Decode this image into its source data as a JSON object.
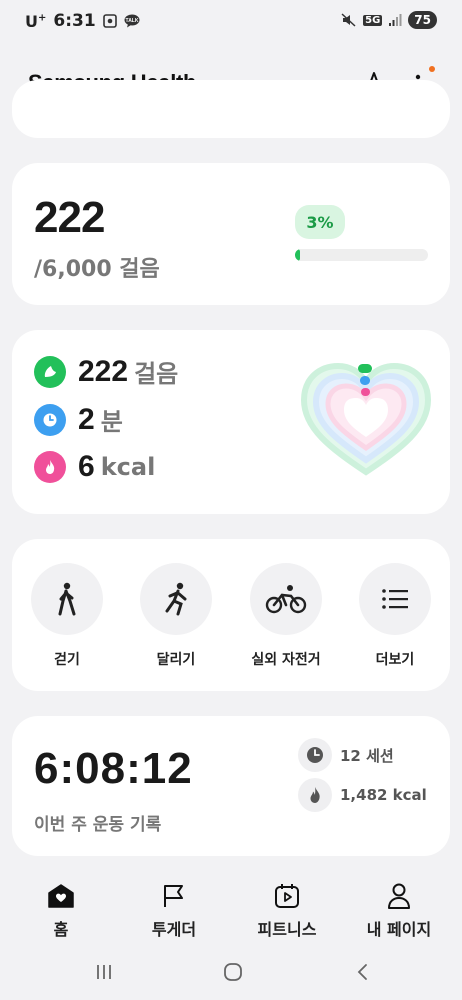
{
  "status_bar": {
    "carrier": "U",
    "carrier_sup": "+",
    "time": "6:31",
    "network": "5G",
    "battery": "75"
  },
  "header": {
    "title": "Samsung Health"
  },
  "steps_card": {
    "steps": "222",
    "goal": "/6,000 걸음",
    "percent_label": "3%",
    "progress_fraction": 0.037
  },
  "activity_card": {
    "steps_value": "222",
    "steps_unit": "걸음",
    "minutes_value": "2",
    "minutes_unit": "분",
    "kcal_value": "6",
    "kcal_unit": "kcal",
    "colors": {
      "steps": "#22c05a",
      "minutes": "#3d9ff0",
      "calories": "#f0509a"
    }
  },
  "workout_card": {
    "items": [
      {
        "label": "걷기",
        "icon": "walking-icon"
      },
      {
        "label": "달리기",
        "icon": "running-icon"
      },
      {
        "label": "실외 자전거",
        "icon": "cycling-icon"
      },
      {
        "label": "더보기",
        "icon": "list-icon"
      }
    ]
  },
  "weekly_card": {
    "time": "6:08:12",
    "label": "이번 주 운동 기록",
    "sessions": "12 세션",
    "calories": "1,482 kcal"
  },
  "bottom_nav": {
    "items": [
      {
        "label": "홈",
        "icon": "home-icon"
      },
      {
        "label": "투게더",
        "icon": "flag-icon"
      },
      {
        "label": "피트니스",
        "icon": "fitness-play-icon"
      },
      {
        "label": "내 페이지",
        "icon": "person-icon"
      }
    ]
  }
}
